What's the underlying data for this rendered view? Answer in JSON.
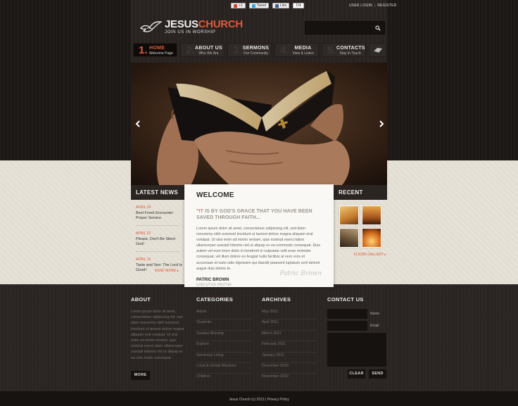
{
  "topbar": {
    "social": [
      {
        "label": "+1",
        "icon": "google-plus-icon",
        "color": "#d44132"
      },
      {
        "label": "Tweet",
        "icon": "twitter-icon",
        "color": "#2ba9e1"
      },
      {
        "label": "Like",
        "icon": "facebook-icon",
        "color": "#3b5998"
      },
      {
        "label": "15k",
        "icon": "count",
        "color": ""
      }
    ],
    "user_login": "USER LOGIN",
    "register": "REGISTER"
  },
  "logo": {
    "name_part1": "JESUS",
    "name_part2": "CHURCH",
    "tagline": "JOIN US IN WORSHIP"
  },
  "search": {
    "placeholder": "",
    "icon": "search-icon"
  },
  "nav": [
    {
      "num": "1.",
      "title": "HOME",
      "sub": "Welcome Page",
      "active": true
    },
    {
      "num": "2.",
      "title": "ABOUT US",
      "sub": "Who We Are",
      "active": false
    },
    {
      "num": "3.",
      "title": "SERMONS",
      "sub": "Our Community",
      "active": false
    },
    {
      "num": "4.",
      "title": "MEDIA",
      "sub": "View & Listen",
      "active": false
    },
    {
      "num": "5.",
      "title": "CONTACTS",
      "sub": "Stay In Touch",
      "active": false
    }
  ],
  "latest_news": {
    "title": "LATEST NEWS",
    "items": [
      {
        "date": "APRIL 29",
        "title": "Best Fresh Encounter Prayer Service"
      },
      {
        "date": "APRIL 22",
        "title": "Please, Don't Be Silent God!"
      },
      {
        "date": "APRIL 15",
        "title": "Taste and See: The Lord Is Good!"
      }
    ],
    "read_more": "READ MORE"
  },
  "welcome": {
    "title": "WELCOME",
    "quote": "IT IS BY GOD'S GRACE THAT YOU HAVE BEEN SAVED THROUGH FAITH...",
    "body": "Lorem ipsum dolor sit amet, consectetuer adipiscing elit, sed diam nonummy nibh euismod tincidunt ut laoreet dolore magna aliquam erat volutpat. Ut wisi enim ad minim veniam, quis nostrud exerci tation ullamcorper suscipit lobortis nisl ut aliquip ex ea commodo consequat. Duis autem vel eum iriure dolor in hendrerit in vulputate velit esse molestie consequat, vel illum dolore eu feugiat nulla facilisis at vero eros et accumsan et iusto odio dignissim qui blandit praesent luptatum zzril delenit augue duis dolore te.",
    "author": "PATRIC BROWN",
    "role": "EXECUTIVE PASTOR",
    "signature": "Patric Brown"
  },
  "recent_photos": {
    "title": "RECENT PHOTOS",
    "gallery_link": "FLICKR GALLERY"
  },
  "footer": {
    "about": {
      "title": "ABOUT",
      "text": "Lorem ipsum dolor sit amet, consectetuer adipiscing elit, sed diam nonummy nibh euismod tincidunt ut laoreet dolore magna aliquam erat volutpat. Ut wisi enim ad minim veniam, quis nostrud exerci ation ullamcorper suscipit lobortis nisl ut aliquip ex ea com modo consequat.",
      "more": "MORE"
    },
    "categories": {
      "title": "CATEGORIES",
      "items": [
        "Adults",
        "Students",
        "Sunday Worship",
        "Explore",
        "Generous Living",
        "Local & Global Missions",
        "Children"
      ]
    },
    "archives": {
      "title": "ARCHIVES",
      "items": [
        "May 2011",
        "April 2011",
        "March 2011",
        "February 2011",
        "January 2011",
        "December 2010",
        "November 2010"
      ]
    },
    "contact": {
      "title": "CONTACT US",
      "name_label": "Name",
      "email_label": "Email",
      "clear": "CLEAR",
      "send": "SEND"
    }
  },
  "copyright": "Jesus Church (c) 2013",
  "privacy": "Privacy Policy"
}
